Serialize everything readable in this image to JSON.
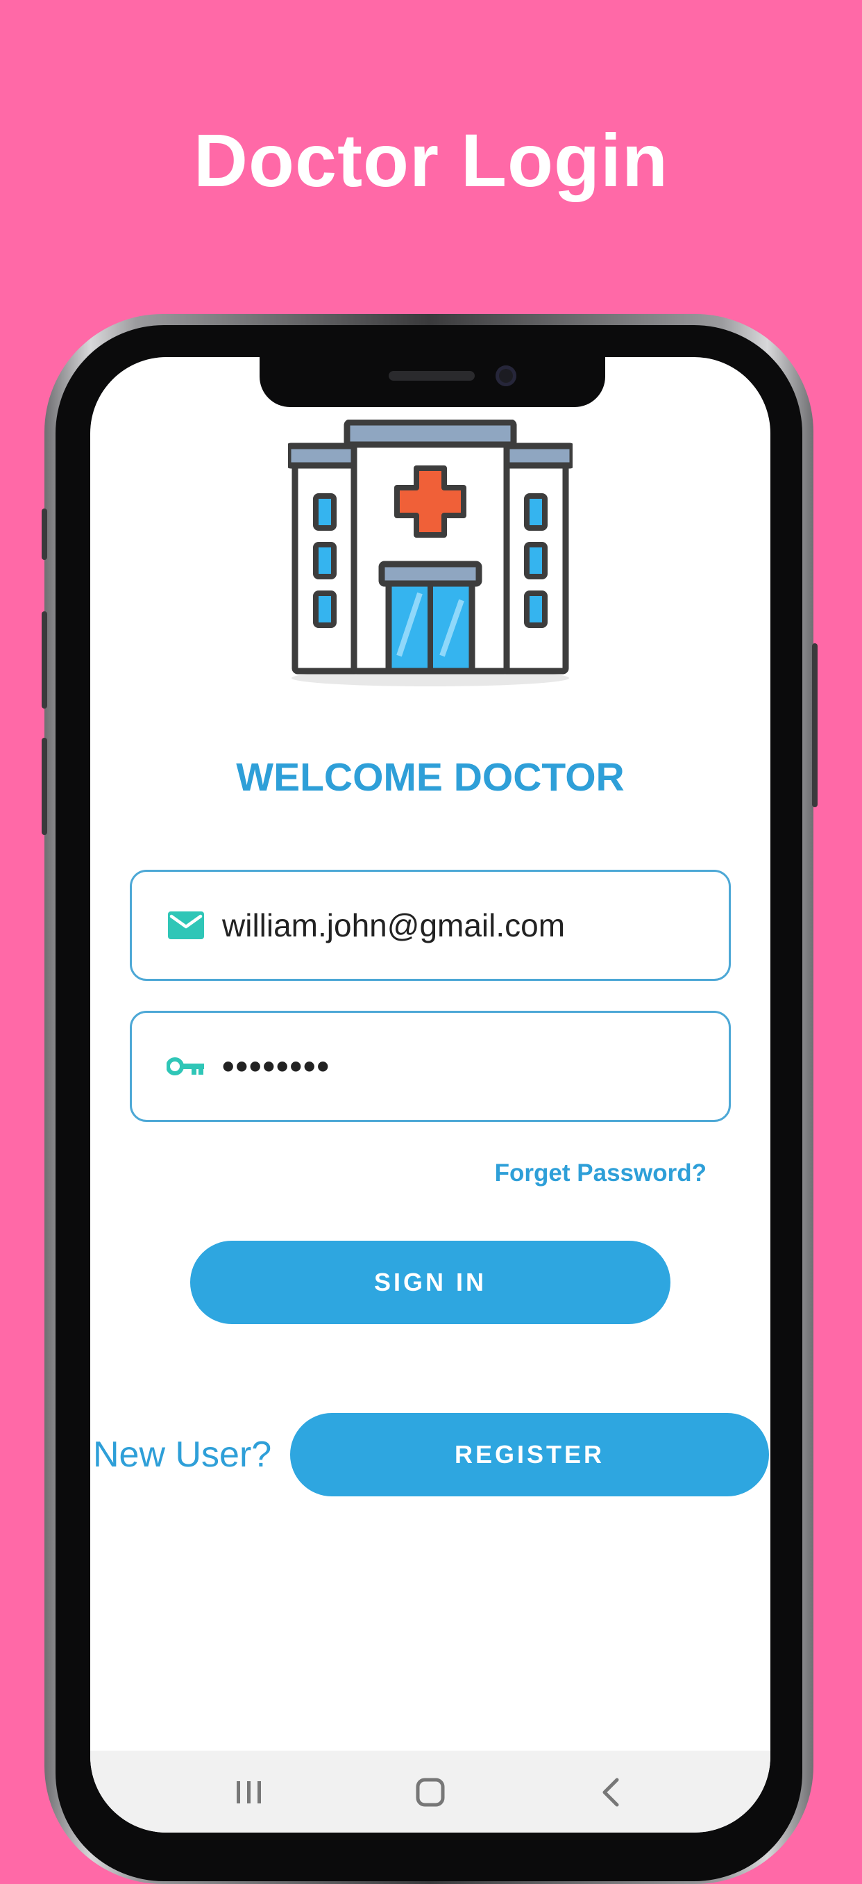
{
  "page": {
    "title": "Doctor Login"
  },
  "app": {
    "welcome": "WELCOME DOCTOR",
    "email": {
      "icon": "mail-icon",
      "value": "william.john@gmail.com"
    },
    "password": {
      "icon": "key-icon",
      "value": "••••••••"
    },
    "forgot_label": "Forget Password?",
    "signin_label": "SIGN IN",
    "new_user_label": "New User?",
    "register_label": "REGISTER"
  },
  "navbar": {
    "items": [
      {
        "icon": "recent-apps-icon"
      },
      {
        "icon": "home-icon"
      },
      {
        "icon": "back-icon"
      }
    ]
  },
  "colors": {
    "background": "#ff69a7",
    "accent": "#2ea6e0",
    "icon_teal": "#2fc6b7",
    "cross": "#f06038"
  }
}
